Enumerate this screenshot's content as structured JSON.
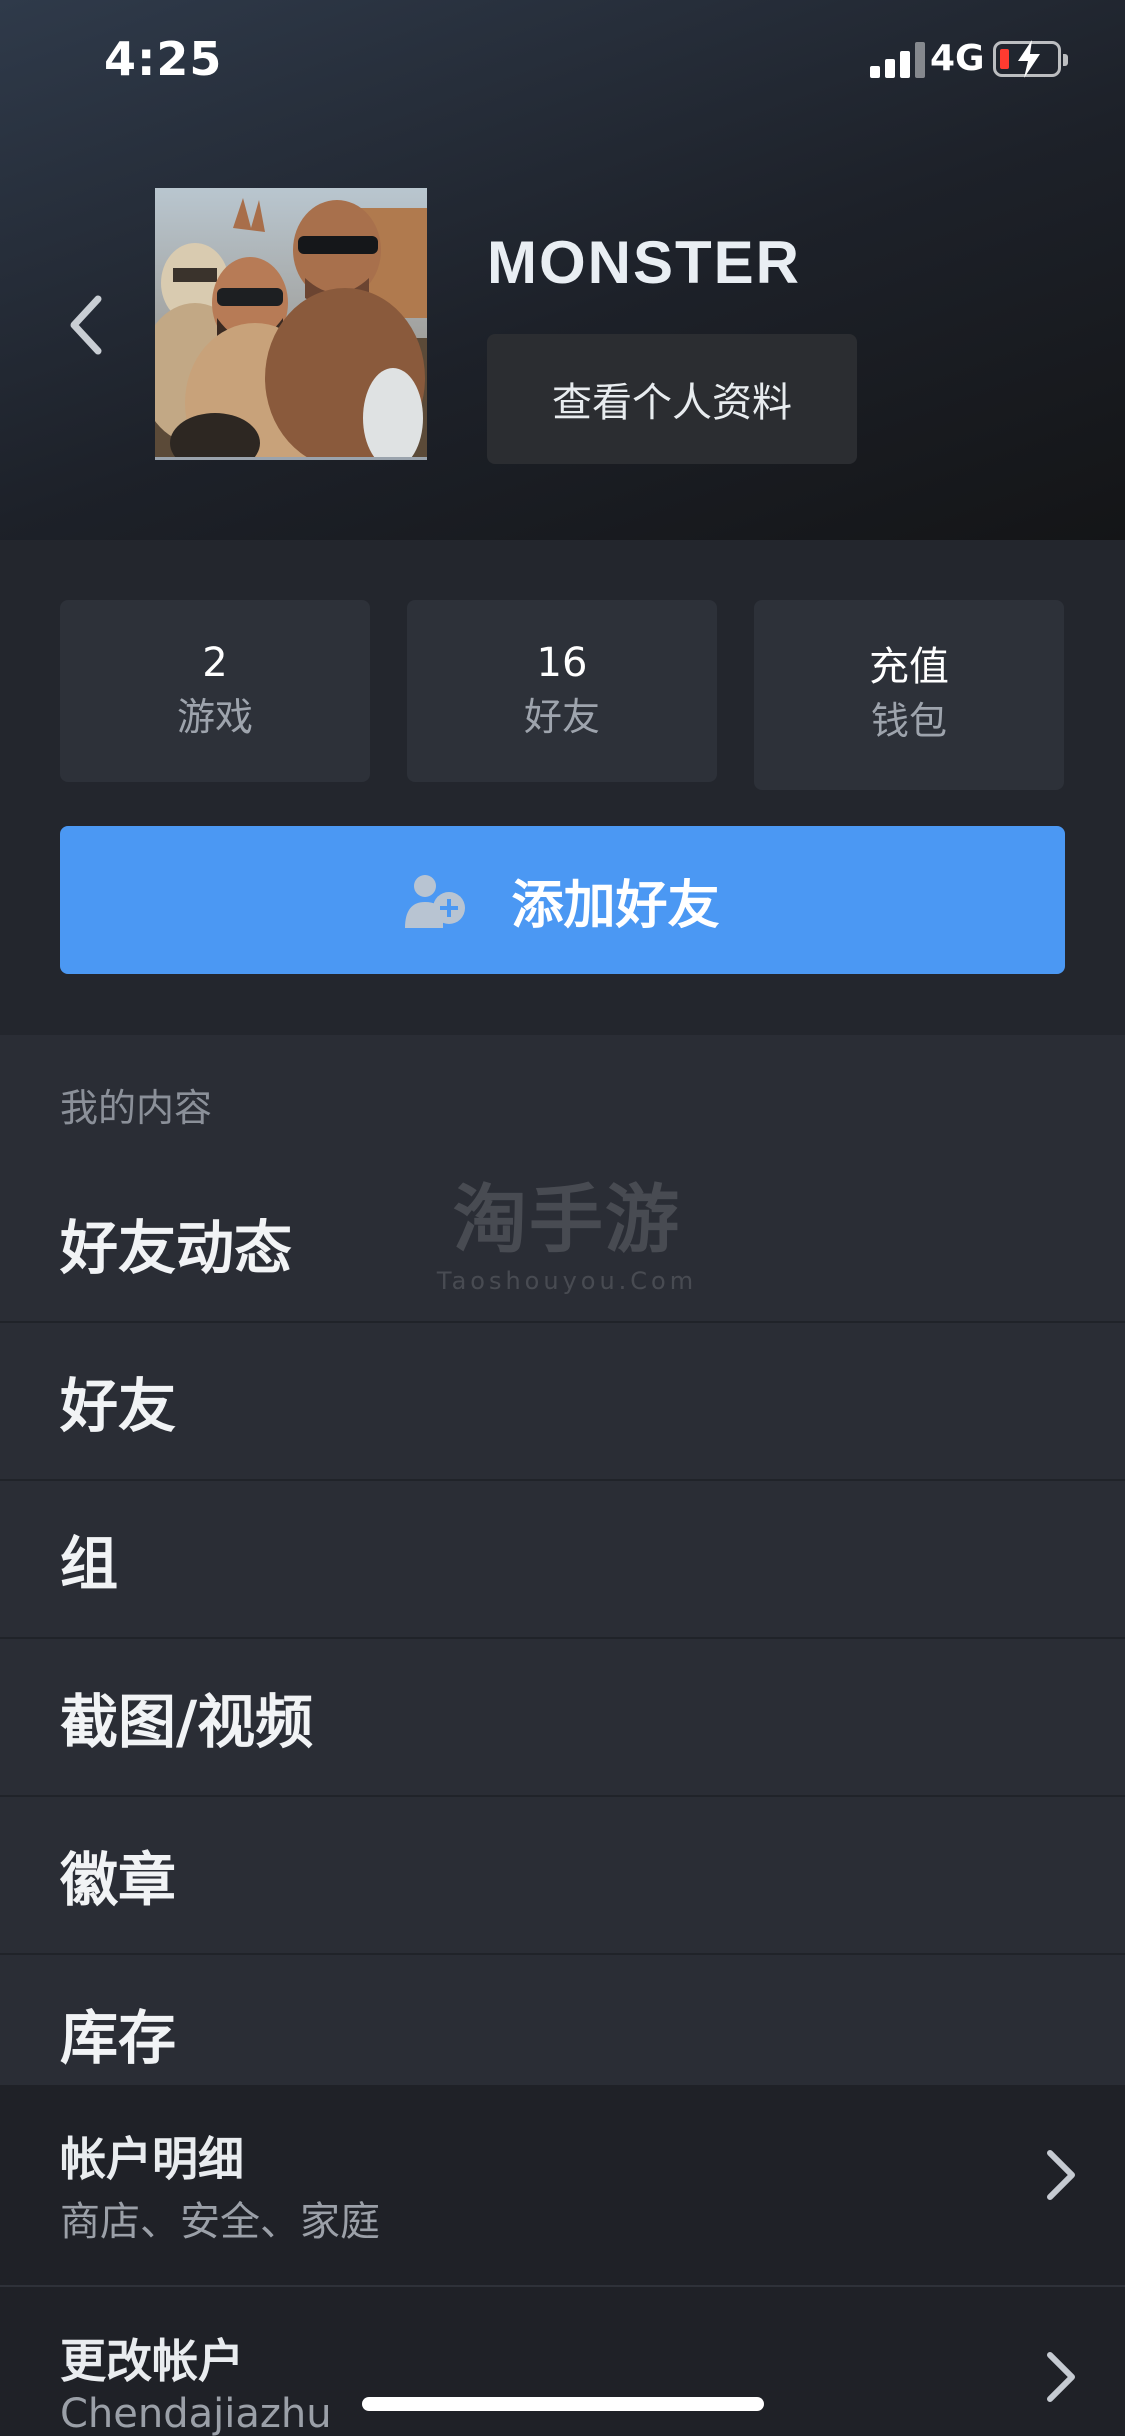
{
  "status_bar": {
    "time": "4:25",
    "network": "4G",
    "battery_level_percent": 10,
    "battery_color": "#ff3b30"
  },
  "profile": {
    "username": "MONSTER",
    "view_profile_label": "查看个人资料",
    "back_icon": "chevron-left-icon",
    "avatar_alt": "avatar"
  },
  "stats": [
    {
      "value": "2",
      "label": "游戏"
    },
    {
      "value": "16",
      "label": "好友"
    },
    {
      "value": "充值",
      "label": "钱包"
    }
  ],
  "add_friend": {
    "label": "添加好友",
    "icon": "add-person-icon",
    "color": "#4b98f3"
  },
  "my_content": {
    "title": "我的内容",
    "items": [
      {
        "label": "好友动态"
      },
      {
        "label": "好友"
      },
      {
        "label": "组"
      },
      {
        "label": "截图/视频"
      },
      {
        "label": "徽章"
      },
      {
        "label": "库存"
      }
    ]
  },
  "watermark": {
    "cn": "淘手游",
    "en": "Taoshouyou.Com"
  },
  "account": {
    "details": {
      "title": "帐户明细",
      "subtitle": "商店、安全、家庭"
    },
    "switch": {
      "title": "更改帐户",
      "subtitle": "Chendajiazhu"
    }
  }
}
